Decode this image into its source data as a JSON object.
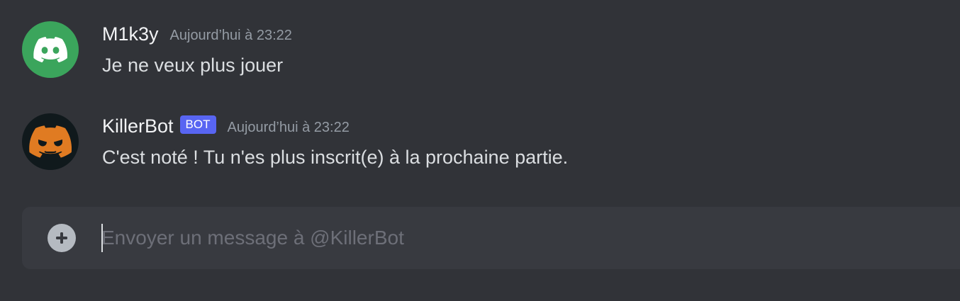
{
  "messages": [
    {
      "author": "M1k3y",
      "timestamp": "Aujourd’hui à 23:22",
      "content": "Je ne veux plus jouer",
      "avatar_icon": "discord-logo-icon",
      "avatar_color": "#3ba55c"
    },
    {
      "author": "KillerBot",
      "bot_tag": "BOT",
      "timestamp": "Aujourd’hui à 23:22",
      "content": "C'est noté ! Tu n'es plus inscrit(e) à la prochaine partie.",
      "avatar_icon": "evil-discord-logo-icon",
      "avatar_color": "#10191c"
    }
  ],
  "composer": {
    "placeholder": "Envoyer un message à @KillerBot",
    "value": "",
    "add_icon": "plus-circle-icon"
  },
  "colors": {
    "background": "#313338",
    "composer_bg": "#383a40",
    "bot_tag": "#5865f2",
    "bot_avatar_accent": "#e07b22"
  }
}
